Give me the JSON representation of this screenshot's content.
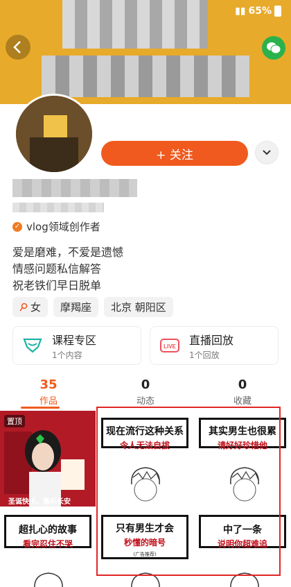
{
  "status_bar": {
    "battery": "65%"
  },
  "header": {
    "back_label": "‹",
    "wechat_icon": "wechat-icon"
  },
  "profile": {
    "follow_label": "+ 关注",
    "creator_label": "vlog领域创作者",
    "bio": [
      "爱是磨难，不爱是遗憾",
      "情感问题私信解答",
      "祝老铁们早日脱单"
    ],
    "tags": [
      {
        "label": "女",
        "icon": "female-icon"
      },
      {
        "label": "摩羯座"
      },
      {
        "label": "北京 朝阳区"
      }
    ]
  },
  "features": [
    {
      "title": "课程专区",
      "sub": "1个内容",
      "icon": "course-icon"
    },
    {
      "title": "直播回放",
      "sub": "1个回放",
      "icon": "live-icon"
    }
  ],
  "tabs": [
    {
      "count": "35",
      "label": "作品"
    },
    {
      "count": "0",
      "label": "动态"
    },
    {
      "count": "0",
      "label": "收藏"
    }
  ],
  "grid": {
    "pinned_label": "置顶",
    "photo_caption": "圣诞快乐，喜乐长安",
    "tiles": [
      {
        "line1": "现在流行这种关系",
        "line2": "令人无法自拔"
      },
      {
        "line1": "其实男生也很累",
        "line2": "请好好珍惜他"
      },
      {
        "line1": "超扎心的故事",
        "line2": "看完忍住不哭"
      },
      {
        "line1": "只有男生才会",
        "line2": "秒懂的暗号",
        "note": "(广告推荐)"
      },
      {
        "line1": "中了一条",
        "line2": "说明你超难追"
      }
    ]
  }
}
